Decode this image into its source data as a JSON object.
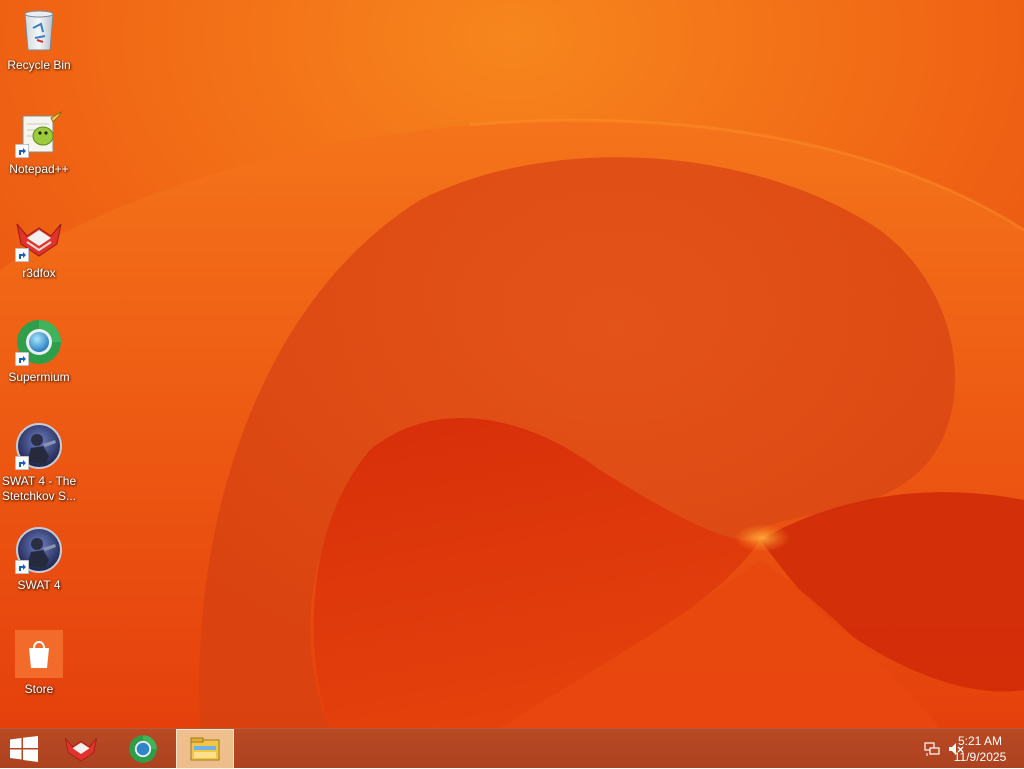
{
  "desktop": {
    "icons": [
      {
        "label": "Recycle Bin",
        "icon": "recycle-bin-icon"
      },
      {
        "label": "Notepad++",
        "icon": "notepad-plus-plus-icon"
      },
      {
        "label": "r3dfox",
        "icon": "r3dfox-icon"
      },
      {
        "label": "Supermium",
        "icon": "supermium-icon"
      },
      {
        "label": "SWAT 4 - The Stetchkov S...",
        "icon": "swat4-icon"
      },
      {
        "label": "SWAT 4",
        "icon": "swat4-icon"
      },
      {
        "label": "Store",
        "icon": "store-icon"
      }
    ]
  },
  "taskbar": {
    "start": {
      "icon": "windows-logo-icon"
    },
    "pinned": [
      {
        "app": "r3dfox",
        "icon": "r3dfox-icon"
      },
      {
        "app": "Supermium",
        "icon": "supermium-icon"
      },
      {
        "app": "File Explorer",
        "icon": "file-explorer-icon",
        "active": true
      }
    ],
    "tray": {
      "icons": [
        "network-icon",
        "volume-muted-icon"
      ],
      "time": "5:21 AM",
      "date": "11/9/2025"
    }
  },
  "colors": {
    "wallpaper_base": "#ec5a12",
    "wallpaper_dark": "#cc1f08",
    "taskbar": "#b84a24",
    "store_tile": "#f26b2a"
  }
}
